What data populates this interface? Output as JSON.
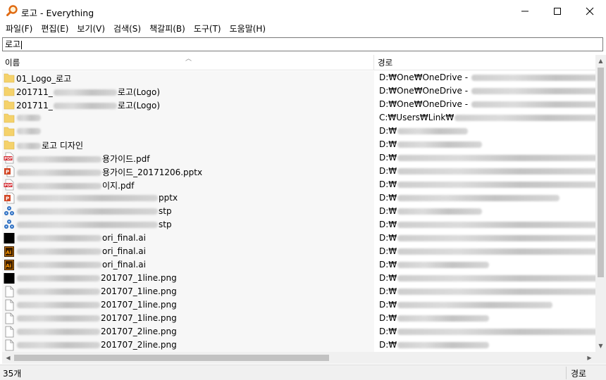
{
  "window": {
    "title": "로고 - Everything",
    "icon": "magnifier-icon",
    "controls": [
      "minimize-icon",
      "maximize-icon",
      "close-icon"
    ]
  },
  "menu": [
    "파일(F)",
    "편집(E)",
    "보기(V)",
    "검색(S)",
    "책갈피(B)",
    "도구(T)",
    "도움말(H)"
  ],
  "search": {
    "value": "로고"
  },
  "columns": {
    "name": "이름",
    "path": "경로"
  },
  "rows": [
    {
      "icon": "folder",
      "name_prefix": "01_Logo_로고",
      "name_mask": 0,
      "name_suffix": "",
      "path_prefix": "D:₩One₩OneDrive - ",
      "path_mask": 200
    },
    {
      "icon": "folder",
      "name_prefix": "201711_",
      "name_mask": 90,
      "name_suffix": "로고(Logo)",
      "path_prefix": "D:₩One₩OneDrive - ",
      "path_mask": 200
    },
    {
      "icon": "folder",
      "name_prefix": "201711_",
      "name_mask": 90,
      "name_suffix": "로고(Logo)",
      "path_prefix": "D:₩One₩OneDrive - ",
      "path_mask": 200
    },
    {
      "icon": "folder",
      "name_prefix": "",
      "name_mask": 34,
      "name_suffix": "",
      "path_prefix": "C:₩Users₩Link₩",
      "path_mask": 220
    },
    {
      "icon": "folder",
      "name_prefix": "",
      "name_mask": 34,
      "name_suffix": "",
      "path_prefix": "D:₩",
      "path_mask": 100
    },
    {
      "icon": "folder",
      "name_prefix": "",
      "name_mask": 34,
      "name_suffix": "로고 디자인",
      "path_prefix": "D:₩",
      "path_mask": 120
    },
    {
      "icon": "pdf",
      "name_prefix": "",
      "name_mask": 120,
      "name_suffix": "용가이드.pdf",
      "path_prefix": "D:₩",
      "path_mask": 290
    },
    {
      "icon": "pptx",
      "name_prefix": "",
      "name_mask": 120,
      "name_suffix": "용가이드_20171206.pptx",
      "path_prefix": "D:₩",
      "path_mask": 290
    },
    {
      "icon": "pdf",
      "name_prefix": "",
      "name_mask": 120,
      "name_suffix": "이지.pdf",
      "path_prefix": "D:₩",
      "path_mask": 290
    },
    {
      "icon": "pptx",
      "name_prefix": "",
      "name_mask": 200,
      "name_suffix": "pptx",
      "path_prefix": "D:₩",
      "path_mask": 230
    },
    {
      "icon": "stp",
      "name_prefix": "",
      "name_mask": 200,
      "name_suffix": "stp",
      "path_prefix": "D:₩",
      "path_mask": 120
    },
    {
      "icon": "stp",
      "name_prefix": "",
      "name_mask": 200,
      "name_suffix": "stp",
      "path_prefix": "D:₩",
      "path_mask": 290
    },
    {
      "icon": "black",
      "name_prefix": "",
      "name_mask": 120,
      "name_suffix": "ori_final.ai",
      "path_prefix": "D:₩",
      "path_mask": 290
    },
    {
      "icon": "ai",
      "name_prefix": "",
      "name_mask": 120,
      "name_suffix": "ori_final.ai",
      "path_prefix": "D:₩",
      "path_mask": 290
    },
    {
      "icon": "ai",
      "name_prefix": "",
      "name_mask": 120,
      "name_suffix": "ori_final.ai",
      "path_prefix": "D:₩",
      "path_mask": 130
    },
    {
      "icon": "black",
      "name_prefix": "",
      "name_mask": 118,
      "name_suffix": "201707_1line.png",
      "path_prefix": "D:₩",
      "path_mask": 290
    },
    {
      "icon": "doc",
      "name_prefix": "",
      "name_mask": 118,
      "name_suffix": "201707_1line.png",
      "path_prefix": "D:₩",
      "path_mask": 290
    },
    {
      "icon": "doc",
      "name_prefix": "",
      "name_mask": 118,
      "name_suffix": "201707_1line.png",
      "path_prefix": "D:₩",
      "path_mask": 220
    },
    {
      "icon": "doc",
      "name_prefix": "",
      "name_mask": 118,
      "name_suffix": "201707_1line.png",
      "path_prefix": "D:₩",
      "path_mask": 130
    },
    {
      "icon": "doc",
      "name_prefix": "",
      "name_mask": 118,
      "name_suffix": "201707_2line.png",
      "path_prefix": "D:₩",
      "path_mask": 290
    },
    {
      "icon": "doc",
      "name_prefix": "",
      "name_mask": 118,
      "name_suffix": "201707_2line.png",
      "path_prefix": "D:₩",
      "path_mask": 130
    }
  ],
  "status": {
    "count": "35개",
    "right": "경로"
  },
  "colors": {
    "folder": "#f5d26b",
    "pdf": "#d2232a",
    "pptx": "#d24726",
    "ai": "#ff9a00",
    "stp": "#2f6fc0"
  }
}
